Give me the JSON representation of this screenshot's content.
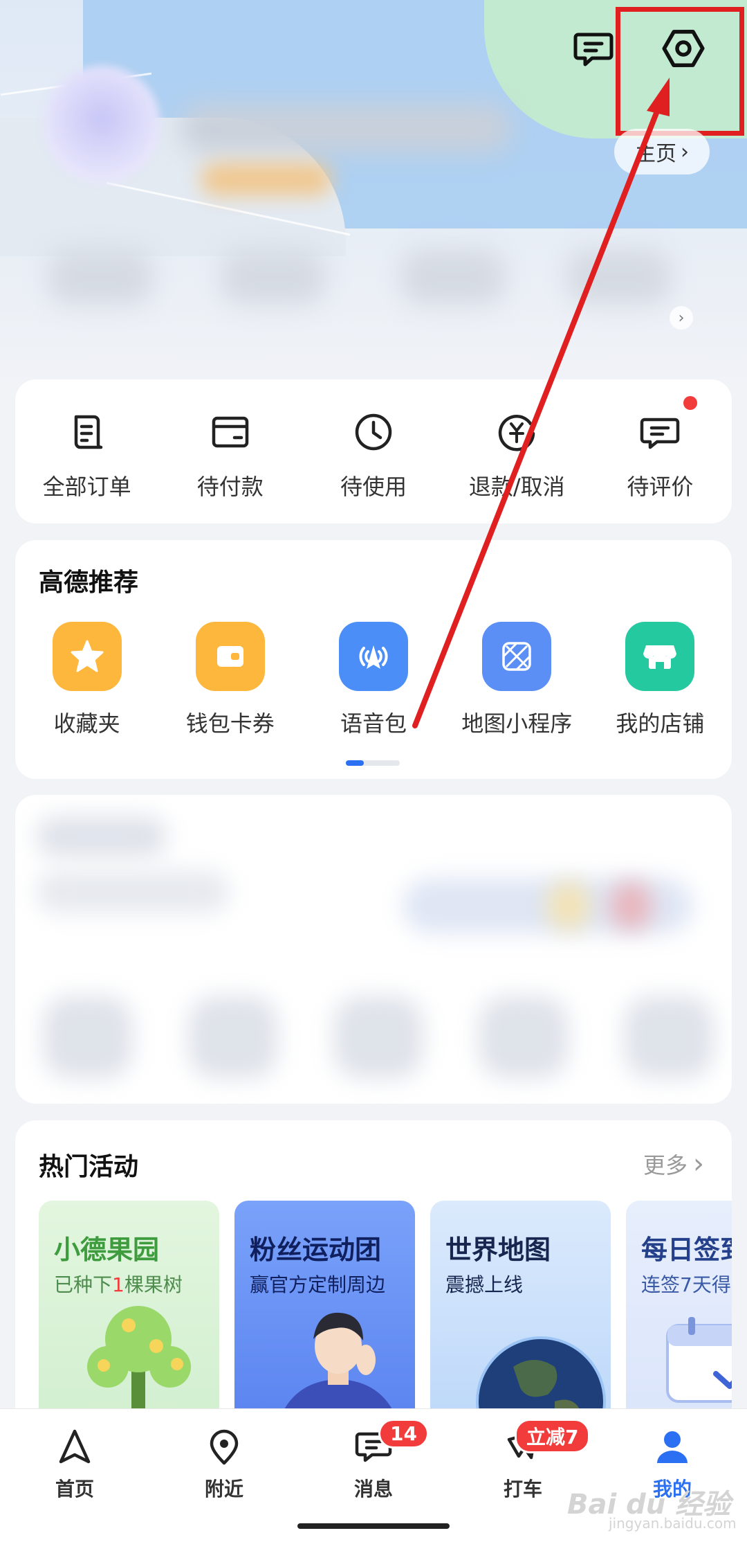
{
  "header": {
    "home_link_label": "主页",
    "home_link_chevron": "›"
  },
  "orders": {
    "items": [
      {
        "label": "全部订单",
        "icon": "order-list-icon"
      },
      {
        "label": "待付款",
        "icon": "wallet-icon"
      },
      {
        "label": "待使用",
        "icon": "clock-icon"
      },
      {
        "label": "退款/取消",
        "icon": "refund-icon"
      },
      {
        "label": "待评价",
        "icon": "comment-icon"
      }
    ]
  },
  "recommend": {
    "title": "高德推荐",
    "items": [
      {
        "label": "收藏夹",
        "icon": "star-icon",
        "color": "#fdb73d"
      },
      {
        "label": "钱包卡券",
        "icon": "card-wallet-icon",
        "color": "#fdb73d"
      },
      {
        "label": "语音包",
        "icon": "voice-pack-icon",
        "color": "#4b8ef7"
      },
      {
        "label": "地图小程序",
        "icon": "mini-program-icon",
        "color": "#5b8ff5"
      },
      {
        "label": "我的店铺",
        "icon": "shop-icon",
        "color": "#25c9a0"
      }
    ]
  },
  "activities": {
    "title": "热门活动",
    "more_label": "更多",
    "cards": [
      {
        "title": "小德果园",
        "sub_pre": "已种下",
        "sub_num": "1",
        "sub_post": "棵果树",
        "bg": "#e5f6e3",
        "title_color": "#3e9b3e"
      },
      {
        "title": "粉丝运动团",
        "sub": "赢官方定制周边",
        "bg": "#6a8ff5",
        "title_color": "#1b2a6b"
      },
      {
        "title": "世界地图",
        "sub": "震撼上线",
        "bg": "#cfe4fb",
        "title_color": "#1b2a5a"
      },
      {
        "title": "每日签到",
        "sub": "连签7天得",
        "bg": "#e4ebfb",
        "title_color": "#24408a"
      }
    ]
  },
  "bottom_nav": {
    "items": [
      {
        "label": "首页",
        "icon": "navigate-arrow-icon"
      },
      {
        "label": "附近",
        "icon": "location-pin-icon"
      },
      {
        "label": "消息",
        "icon": "message-icon",
        "badge": "14"
      },
      {
        "label": "打车",
        "icon": "taxi-icon",
        "badge": "立减7"
      },
      {
        "label": "我的",
        "icon": "user-icon",
        "active": true
      }
    ]
  },
  "watermark": {
    "main": "Bai du 经验",
    "sub": "jingyan.baidu.com"
  },
  "colors": {
    "accent": "#2b6ff2",
    "badge": "#f23b3b",
    "annotation": "#e02020"
  }
}
